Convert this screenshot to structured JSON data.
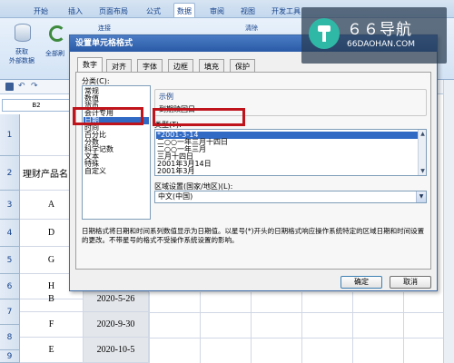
{
  "ribbon": {
    "tabs": [
      "开始",
      "插入",
      "页面布局",
      "公式",
      "数据",
      "审阅",
      "视图",
      "开发工具"
    ],
    "active_tab": "数据",
    "get_external_data": "获取\n外部数据",
    "refresh_all": "全部刷",
    "connections": "连接",
    "clear": "清除",
    "name_box": "B2"
  },
  "sheet": {
    "row_numbers": [
      "1",
      "2",
      "3",
      "4",
      "5",
      "6",
      "7",
      "8",
      "9",
      "10"
    ],
    "row1_red_text": "财",
    "row2_col_a": "理财产品名",
    "col_a": [
      "A",
      "D",
      "G",
      "C",
      "H",
      "B",
      "F",
      "E"
    ],
    "col_b": [
      "",
      "",
      "",
      "",
      "",
      "2020-5-26",
      "2020-9-30",
      "2020-10-5"
    ]
  },
  "dialog": {
    "title": "设置单元格格式",
    "tabs": [
      "数字",
      "对齐",
      "字体",
      "边框",
      "填充",
      "保护"
    ],
    "active_tab": "数字",
    "category_label": "分类(C):",
    "categories": [
      "常规",
      "数值",
      "货币",
      "会计专用",
      "日期",
      "时间",
      "百分比",
      "分数",
      "科学记数",
      "文本",
      "特殊",
      "自定义"
    ],
    "selected_category": "日期",
    "sample_label": "示例",
    "sample_value": "到期赎回日",
    "type_label": "类型(T):",
    "types": [
      "*2001-3-14",
      "二○○一年三月十四日",
      "二○○一年三月",
      "三月十四日",
      "2001年3月14日",
      "2001年3月"
    ],
    "selected_type": "*2001-3-14",
    "locale_label": "区域设置(国家/地区)(L):",
    "locale_value": "中文(中国)",
    "description": "日期格式将日期和时间系列数值显示为日期值。以星号(*)开头的日期格式响应操作系统特定的区域日期和时间设置的更改。不带星号的格式不受操作系统设置的影响。",
    "ok": "确定",
    "cancel": "取消"
  },
  "watermark": {
    "title": "６６导航",
    "url": "66DAOHAN.COM"
  },
  "colors": {
    "accent": "#2a5aa6",
    "highlight_box": "#c0141c",
    "selection": "#316ac5"
  }
}
